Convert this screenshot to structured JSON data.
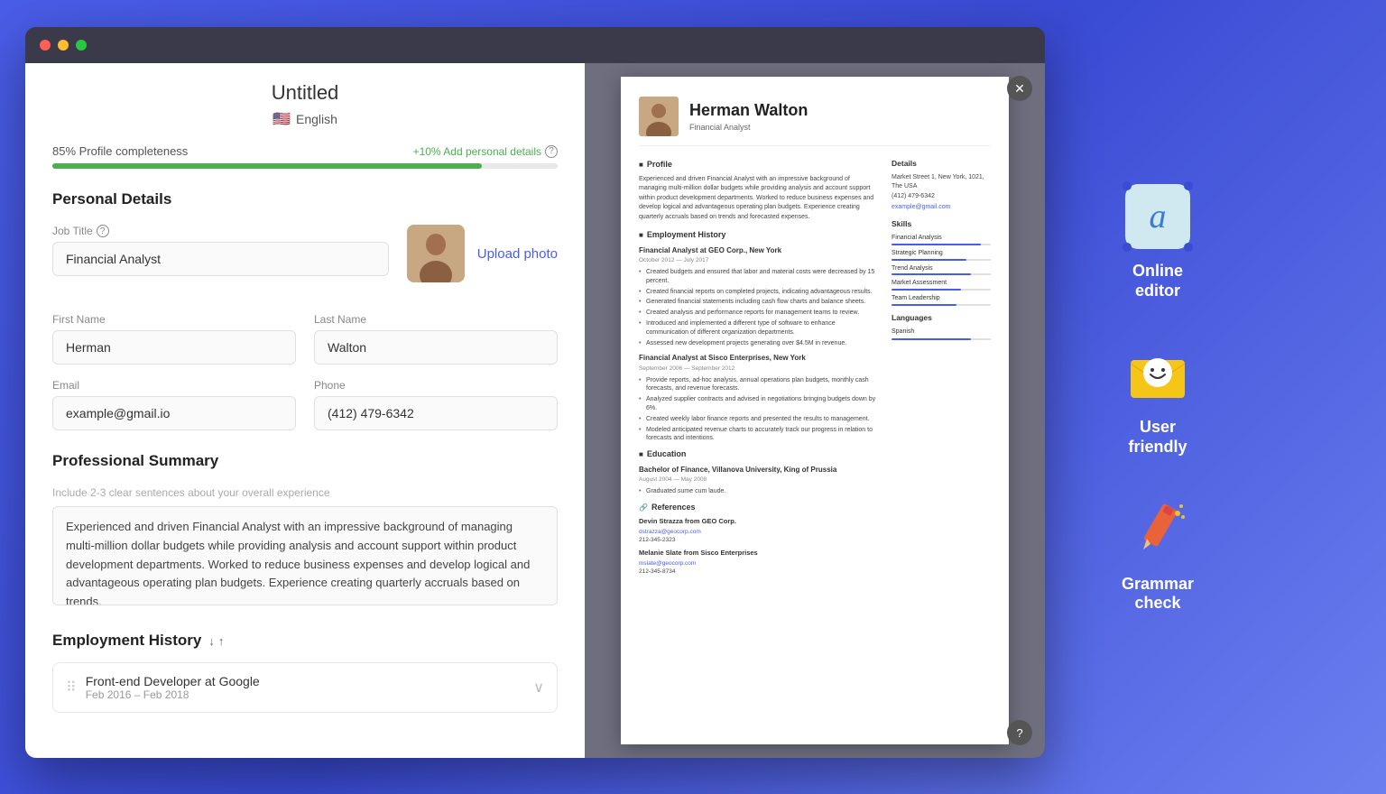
{
  "browser": {
    "dots": [
      "red",
      "yellow",
      "green"
    ]
  },
  "editor": {
    "title": "Untitled",
    "language": "English",
    "progress_label": "85% Profile completeness",
    "progress_add": "+10% Add personal details",
    "progress_percent": 85,
    "sections": {
      "personal_details": "Personal Details",
      "professional_summary": "Professional Summary",
      "employment_history": "Employment History"
    },
    "job_title_label": "Job Title",
    "job_title_value": "Financial Analyst",
    "upload_photo": "Upload photo",
    "first_name_label": "First Name",
    "first_name_value": "Herman",
    "last_name_label": "Last Name",
    "last_name_value": "Walton",
    "email_label": "Email",
    "email_value": "example@gmail.io",
    "phone_label": "Phone",
    "phone_value": "(412) 479-6342",
    "summary_placeholder": "Include 2-3 clear sentences about your overall experience",
    "summary_value": "Experienced and driven Financial Analyst with an impressive background of managing multi-million dollar budgets while providing analysis and account support within product development departments. Worked to reduce business expenses and develop logical and advantageous operating plan budgets. Experience creating quarterly accruals based on trends.",
    "emp_item_title": "Front-end Developer at Google",
    "emp_item_date": "Feb 2016 – Feb 2018"
  },
  "resume": {
    "name": "Herman Walton",
    "job_title": "Financial Analyst",
    "profile_title": "Profile",
    "profile_text": "Experienced and driven Financial Analyst with an impressive background of managing multi-million dollar budgets while providing analysis and account support within product development departments. Worked to reduce business expenses and develop logical and advantageous operating plan budgets. Experience creating quarterly accruals based on trends and forecasted expenses.",
    "emp_history_title": "Employment History",
    "job1_title": "Financial Analyst at GEO Corp., New York",
    "job1_date": "October 2012 — July 2017",
    "job1_bullets": [
      "Created budgets and ensured that labor and material costs were decreased by 15 percent.",
      "Created financial reports on completed projects, indicating advantageous results.",
      "Generated financial statements including cash flow charts and balance sheets.",
      "Created analysis and performance reports for management teams to review.",
      "Introduced and implemented a different type of software to enhance communication of different organization departments.",
      "Assessed new development projects generating over $4.5M in revenue."
    ],
    "job2_title": "Financial Analyst at Sisco Enterprises, New York",
    "job2_date": "September 2006 — September 2012",
    "job2_bullets": [
      "Provide reports, ad-hoc analysis, annual operations plan budgets, monthly cash forecasts, and revenue forecasts.",
      "Analyzed supplier contracts and advised in negotiations bringing budgets down by 6%.",
      "Created weekly labor finance reports and presented the results to management.",
      "Modeled anticipated revenue charts to accurately track our progress in relation to forecasts and intentions."
    ],
    "education_title": "Education",
    "edu1": "Bachelor of Finance, Villanova University, King of Prussia",
    "edu1_date": "August 2004 — May 2008",
    "edu1_note": "Graduated sume cum laude.",
    "references_title": "References",
    "ref1_name": "Devin Strazza from GEO Corp.",
    "ref1_email": "dstrazza@geocorp.com",
    "ref1_phone": "212-345-2323",
    "ref2_name": "Melanie Slate from Sisco Enterprises",
    "ref2_email": "mslate@geocorp.com",
    "ref2_phone": "212-345-8734",
    "details_title": "Details",
    "details_address": "Market Street 1, New York, 1021, The USA",
    "details_phone": "(412) 479-6342",
    "details_email": "example@gmail.com",
    "skills_title": "Skills",
    "skills": [
      {
        "name": "Financial Analysis",
        "pct": 90
      },
      {
        "name": "Strategic Planning",
        "pct": 75
      },
      {
        "name": "Trend Analysis",
        "pct": 80
      },
      {
        "name": "Market Assessment",
        "pct": 70
      },
      {
        "name": "Team Leadership",
        "pct": 65
      }
    ],
    "languages_title": "Languages",
    "languages": [
      {
        "name": "Spanish",
        "pct": 80
      }
    ]
  },
  "features": [
    {
      "id": "online-editor",
      "label": "Online\neditor",
      "icon_type": "editor"
    },
    {
      "id": "user-friendly",
      "label": "User\nfriendly",
      "icon_type": "envelope"
    },
    {
      "id": "grammar-check",
      "label": "Grammar\ncheck",
      "icon_type": "pen"
    }
  ]
}
